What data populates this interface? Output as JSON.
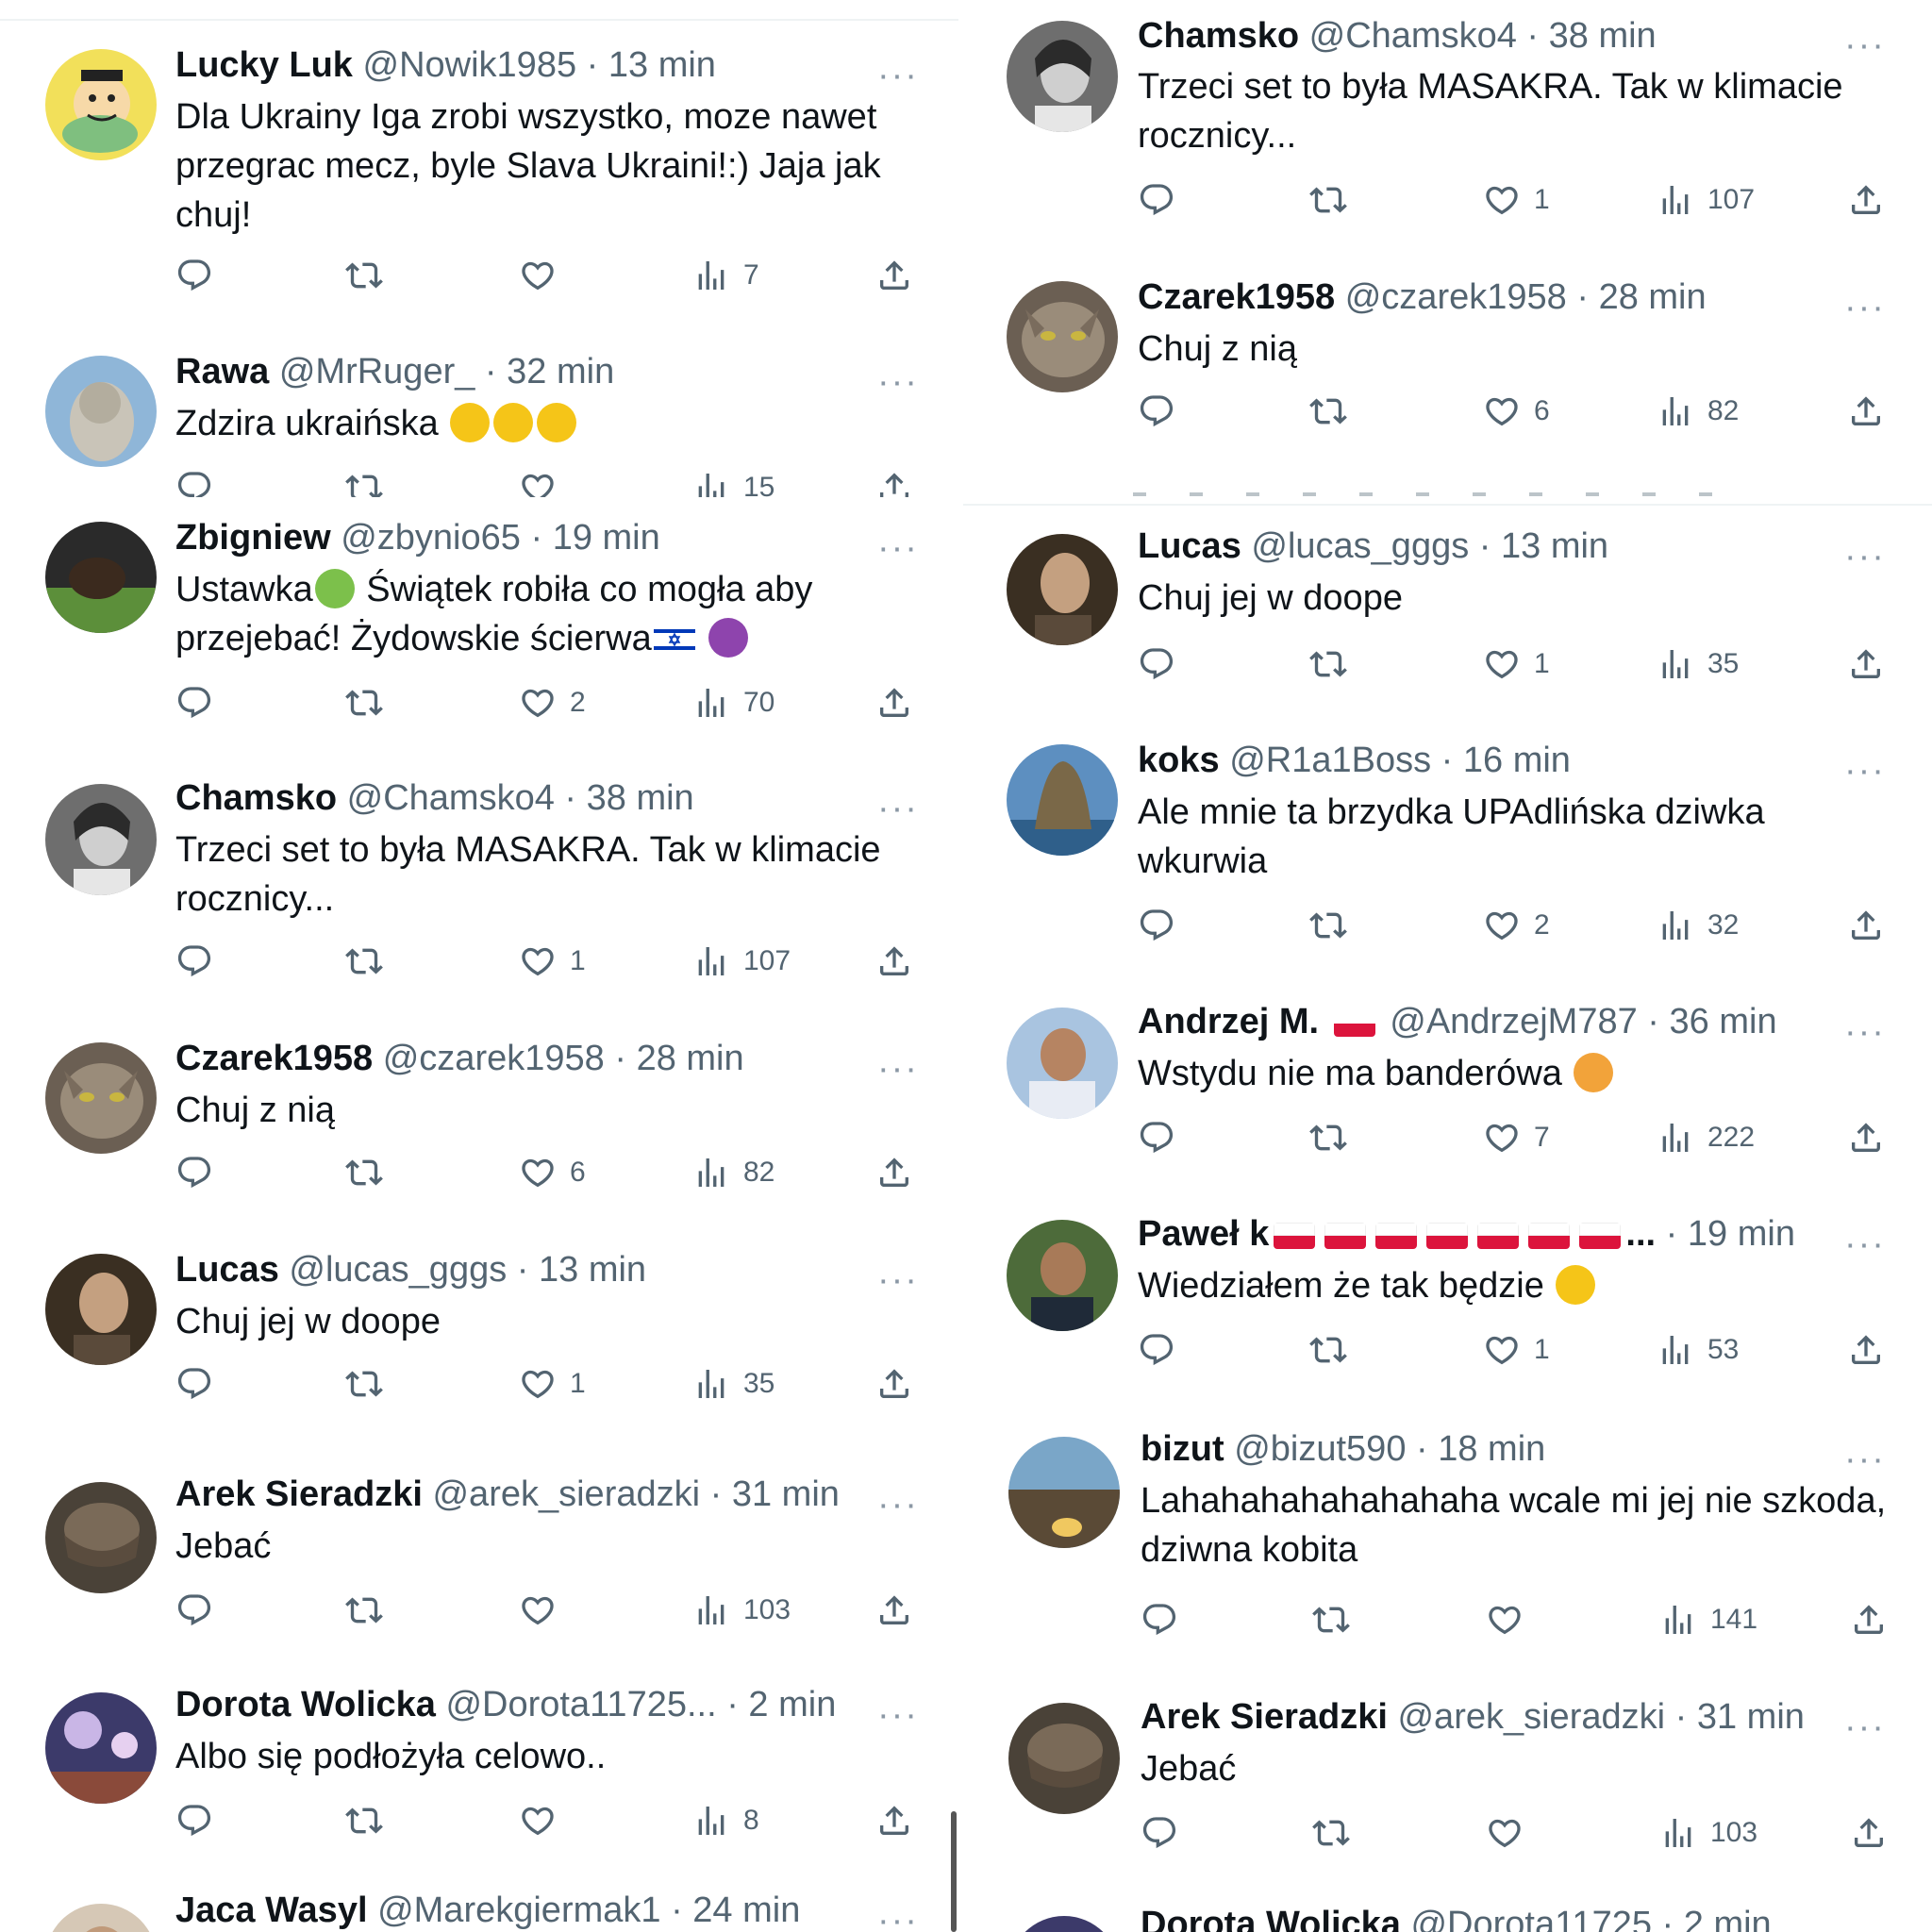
{
  "left_tweets": [
    {
      "name": "Lucky Luk",
      "handle": "@Nowik1985",
      "sep": "·",
      "time": "13 min",
      "text": "Dla Ukrainy Iga zrobi wszystko, moze nawet przegrac mecz, byle Slava Ukraini!:) Jaja jak chuj!",
      "likes": "",
      "views": "7"
    },
    {
      "name": "Rawa",
      "handle": "@MrRuger_",
      "sep": "·",
      "time": "32 min",
      "text": "Zdzira ukraińska",
      "likes": "",
      "views": "15"
    },
    {
      "name": "Zbigniew",
      "handle": "@zbynio65",
      "sep": "·",
      "time": "19 min",
      "text_a": "Ustawka",
      "text_b": " Świątek robiła co mogła aby przejebać! Żydowskie ścierwa",
      "likes": "2",
      "views": "70"
    },
    {
      "name": "Chamsko",
      "handle": "@Chamsko4",
      "sep": "·",
      "time": "38 min",
      "text": "Trzeci set to była MASAKRA. Tak w klimacie rocznicy...",
      "likes": "1",
      "views": "107"
    },
    {
      "name": "Czarek1958",
      "handle": "@czarek1958",
      "sep": "·",
      "time": "28 min",
      "text": "Chuj z nią",
      "likes": "6",
      "views": "82"
    },
    {
      "name": "Lucas",
      "handle": "@lucas_gggs",
      "sep": "·",
      "time": "13 min",
      "text": "Chuj jej w doope",
      "likes": "1",
      "views": "35"
    },
    {
      "name": "Arek Sieradzki",
      "handle": "@arek_sieradzki",
      "sep": "·",
      "time": "31 min",
      "text": "Jebać",
      "likes": "",
      "views": "103"
    },
    {
      "name": "Dorota Wolicka",
      "handle": "@Dorota11725...",
      "sep": "·",
      "time": "2 min",
      "text": "Albo się podłożyła celowo..",
      "likes": "",
      "views": "8"
    },
    {
      "name": "Jaca Wasyl",
      "handle": "@Marekgiermak1",
      "sep": "·",
      "time": "24 min"
    }
  ],
  "right_tweets": [
    {
      "name": "Chamsko",
      "handle": "@Chamsko4",
      "sep": "·",
      "time": "38 min",
      "text": "Trzeci set to była MASAKRA. Tak w klimacie rocznicy...",
      "likes": "1",
      "views": "107"
    },
    {
      "name": "Czarek1958",
      "handle": "@czarek1958",
      "sep": "·",
      "time": "28 min",
      "text": "Chuj z nią",
      "likes": "6",
      "views": "82"
    },
    {
      "name": "Lucas",
      "handle": "@lucas_gggs",
      "sep": "·",
      "time": "13 min",
      "text": "Chuj jej w doope",
      "likes": "1",
      "views": "35"
    },
    {
      "name": "koks",
      "handle": "@R1a1Boss",
      "sep": "·",
      "time": "16 min",
      "text": "Ale mnie ta brzydka UPAdlińska dziwka wkurwia",
      "likes": "2",
      "views": "32"
    },
    {
      "name": "Andrzej M.",
      "handle": "@AndrzejM787",
      "sep": "·",
      "time": "36 min",
      "text": "Wstydu nie ma banderówa",
      "likes": "7",
      "views": "222"
    },
    {
      "name": "Paweł k",
      "name_suffix": "...",
      "sep": "·",
      "time": "19 min",
      "text": "Wiedziałem że tak będzie",
      "likes": "1",
      "views": "53"
    },
    {
      "name": "bizut",
      "handle": "@bizut590",
      "sep": "·",
      "time": "18 min",
      "text": "Lahahahahahahahaha wcale mi jej nie szkoda, dziwna kobita",
      "likes": "",
      "views": "141"
    },
    {
      "name": "Arek Sieradzki",
      "handle": "@arek_sieradzki",
      "sep": "·",
      "time": "31 min",
      "text": "Jebać",
      "likes": "",
      "views": "103"
    },
    {
      "name": "Dorota Wolicka",
      "handle": "@Dorota11725",
      "sep": "·",
      "time": "2 min"
    }
  ],
  "more_label": "···",
  "icons": [
    "reply-icon",
    "retweet-icon",
    "like-icon",
    "views-icon",
    "share-icon",
    "more-icon"
  ],
  "colors": {
    "text": "#0f1419",
    "secondary": "#536471",
    "divider": "#eff3f4",
    "flag_red": "#dc143c",
    "israel_blue": "#0038b8"
  }
}
